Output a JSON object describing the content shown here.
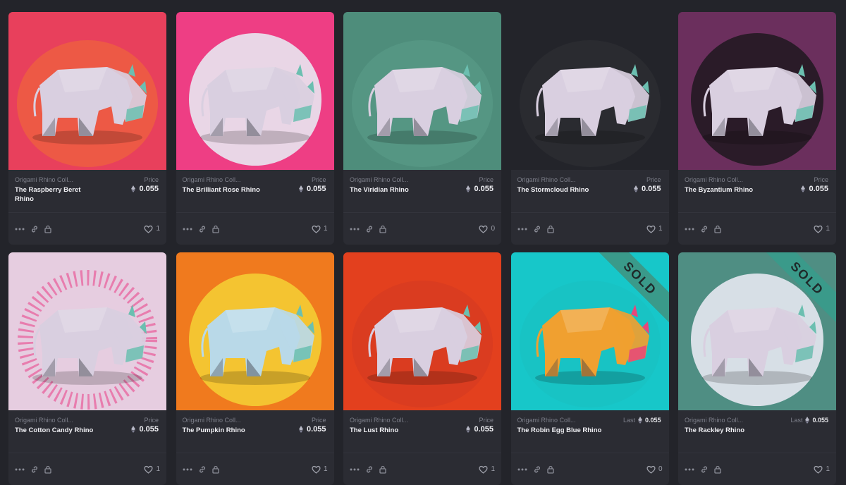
{
  "colors": {
    "page_bg": "#23242a",
    "card_bg": "#2b2c33",
    "sold_ribbon": "#3a9a8a"
  },
  "icons": {
    "more": "more-icon",
    "link": "link-icon",
    "lock": "lock-icon",
    "heart": "heart-icon",
    "eth": "eth-icon"
  },
  "cards": [
    {
      "collection": "Origami Rhino Coll...",
      "name": "The Raspberry Beret Rhino",
      "price_label": "Price",
      "price": "0.055",
      "likes": "1",
      "sold": false,
      "art": {
        "bg": "#e8405c",
        "halo": "#f06a35",
        "halo_shape": "glow",
        "body": "#d9cfe0",
        "accent": "#6bbfb0"
      }
    },
    {
      "collection": "Origami Rhino Coll...",
      "name": "The Brilliant Rose Rhino",
      "price_label": "Price",
      "price": "0.055",
      "likes": "1",
      "sold": false,
      "art": {
        "bg": "#ee3e84",
        "halo": "#e9d6e6",
        "halo_shape": "circle",
        "body": "#d9cfe0",
        "accent": "#6bbfb0"
      }
    },
    {
      "collection": "Origami Rhino Coll...",
      "name": "The Viridian Rhino",
      "price_label": "Price",
      "price": "0.055",
      "likes": "0",
      "sold": false,
      "art": {
        "bg": "#4e8d7b",
        "halo": "#5a9c88",
        "halo_shape": "glow",
        "body": "#d9cfe0",
        "accent": "#6bbfb0"
      }
    },
    {
      "collection": "Origami Rhino Coll...",
      "name": "The Stormcloud Rhino",
      "price_label": "Price",
      "price": "0.055",
      "likes": "1",
      "sold": false,
      "art": {
        "bg": "#23242a",
        "halo": "#2f3036",
        "halo_shape": "glow",
        "body": "#d9cfe0",
        "accent": "#6bbfb0"
      }
    },
    {
      "collection": "Origami Rhino Coll...",
      "name": "The Byzantium Rhino",
      "price_label": "Price",
      "price": "0.055",
      "likes": "1",
      "sold": false,
      "art": {
        "bg": "#6b2f5d",
        "halo": "#2a1b28",
        "halo_shape": "circle",
        "body": "#d9cfe0",
        "accent": "#6bbfb0"
      }
    },
    {
      "collection": "Origami Rhino Coll...",
      "name": "The Cotton Candy Rhino",
      "price_label": "Price",
      "price": "0.055",
      "likes": "1",
      "sold": false,
      "art": {
        "bg": "#e6cde0",
        "halo": "#e8629e",
        "halo_shape": "ring",
        "body": "#d9cfe0",
        "accent": "#6bbfb0"
      }
    },
    {
      "collection": "Origami Rhino Coll...",
      "name": "The Pumpkin Rhino",
      "price_label": "Price",
      "price": "0.055",
      "likes": "1",
      "sold": false,
      "art": {
        "bg": "#f07a1e",
        "halo": "#f4c431",
        "halo_shape": "circle",
        "body": "#b9d9e8",
        "accent": "#6bbfb0"
      }
    },
    {
      "collection": "Origami Rhino Coll...",
      "name": "The Lust Rhino",
      "price_label": "Price",
      "price": "0.055",
      "likes": "1",
      "sold": false,
      "art": {
        "bg": "#e3401e",
        "halo": "#d43a22",
        "halo_shape": "glow",
        "body": "#d9cfe0",
        "accent": "#6bbfb0"
      }
    },
    {
      "collection": "Origami Rhino Coll...",
      "name": "The Robin Egg Blue Rhino",
      "price_label": "Last",
      "price": "0.055",
      "likes": "0",
      "sold": true,
      "sold_label": "SOLD",
      "art": {
        "bg": "#17c7c9",
        "halo": "#19bfc2",
        "halo_shape": "glow",
        "body": "#f0a030",
        "accent": "#e8467a"
      }
    },
    {
      "collection": "Origami Rhino Coll...",
      "name": "The Rackley Rhino",
      "price_label": "Last",
      "price": "0.055",
      "likes": "1",
      "sold": true,
      "sold_label": "SOLD",
      "art": {
        "bg": "#4f8e83",
        "halo": "#d7dfe6",
        "halo_shape": "circle",
        "body": "#d9cfe0",
        "accent": "#6bbfb0"
      }
    }
  ]
}
